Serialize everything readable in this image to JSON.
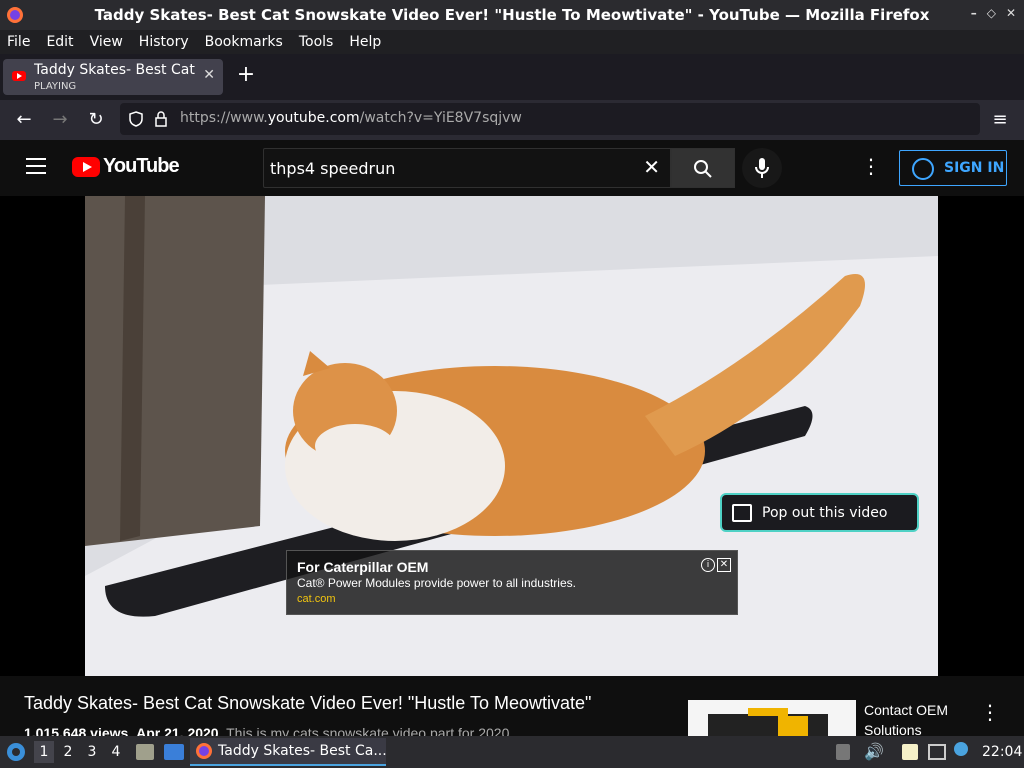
{
  "window": {
    "title": "Taddy Skates- Best Cat Snowskate Video Ever! \"Hustle To Meowtivate\" - YouTube — Mozilla Firefox"
  },
  "menubar": [
    "File",
    "Edit",
    "View",
    "History",
    "Bookmarks",
    "Tools",
    "Help"
  ],
  "tab": {
    "title": "Taddy Skates- Best Cat S",
    "status": "PLAYING"
  },
  "urlbar": {
    "prefix": "https://www.",
    "domain": "youtube.com",
    "path": "/watch?v=YiE8V7sqjvw"
  },
  "youtube": {
    "logo_text": "YouTube",
    "search_value": "thps4 speedrun",
    "sign_in": "SIGN IN",
    "popout": "Pop out this video",
    "ad": {
      "headline": "For Caterpillar OEM",
      "desc": "Cat® Power Modules provide power to all industries.",
      "link": "cat.com"
    },
    "video_title": "Taddy Skates- Best Cat Snowskate Video Ever! \"Hustle To Meowtivate\"",
    "views": "1,015,648 views",
    "date": "Apr 21, 2020",
    "desc": "This is my cats snowskate video part for 2020.",
    "side_ad_title": "Contact OEM Solutions"
  },
  "taskbar": {
    "workspaces": [
      "1",
      "2",
      "3",
      "4"
    ],
    "window_title": "Taddy Skates- Best Ca...",
    "clock": "22:04"
  },
  "colors": {
    "accent": "#3ea6ff",
    "yt_red": "#ff0000",
    "popout_border": "#4fd1c5"
  }
}
